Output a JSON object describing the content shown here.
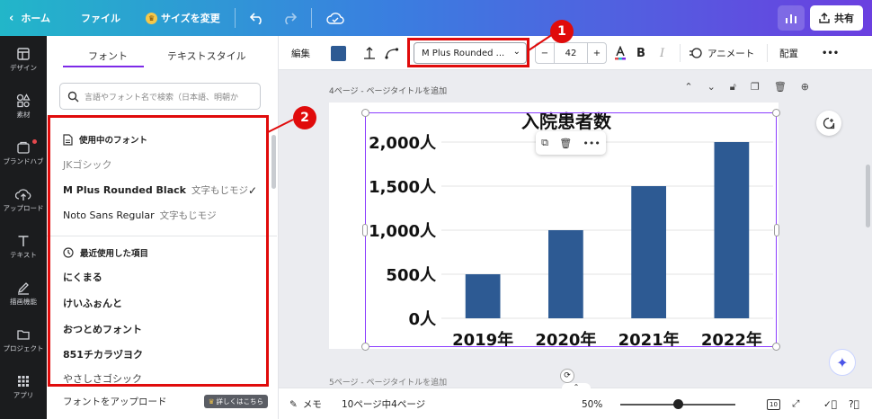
{
  "topbar": {
    "home": "ホーム",
    "file": "ファイル",
    "resize": "サイズを変更",
    "share": "共有"
  },
  "rail": [
    {
      "label": "デザイン",
      "icon": "layout-icon"
    },
    {
      "label": "素材",
      "icon": "shapes-icon"
    },
    {
      "label": "ブランドハブ",
      "icon": "brand-icon"
    },
    {
      "label": "アップロード",
      "icon": "upload-icon"
    },
    {
      "label": "テキスト",
      "icon": "text-icon"
    },
    {
      "label": "描画機能",
      "icon": "draw-icon"
    },
    {
      "label": "プロジェクト",
      "icon": "folder-icon"
    },
    {
      "label": "アプリ",
      "icon": "apps-icon"
    }
  ],
  "panel": {
    "tabs": [
      "フォント",
      "テキストスタイル"
    ],
    "search_placeholder": "言語やフォント名で検索（日本語、明朝か",
    "in_use_header": "使用中のフォント",
    "in_use": [
      {
        "name": "JKゴシック",
        "sample": ""
      },
      {
        "name": "M Plus Rounded Black",
        "sample": "文字もじモジ"
      },
      {
        "name": "Noto Sans Regular",
        "sample": "文字もじモジ"
      }
    ],
    "recent_header": "最近使用した項目",
    "recent": [
      "にくまる",
      "けいふぉんと",
      "おつとめフォント",
      "851チカラヅヨク",
      "やさしさゴシック"
    ],
    "upload": "フォントをアップロード",
    "upload_badge": "詳しくはこちら"
  },
  "annotations": [
    "1",
    "2"
  ],
  "toolbar": {
    "edit": "編集",
    "color": "#2d5a93",
    "font_name": "M Plus Rounded ...",
    "font_size": "42",
    "bold": "B",
    "italic": "I",
    "animate": "アニメート",
    "arrange": "配置",
    "more": "•••",
    "minus": "−",
    "plus": "+"
  },
  "canvas": {
    "page_label": "4ページ - ページタイトルを追加",
    "next_page_label": "5ページ - ページタイトルを追加"
  },
  "chart_data": {
    "type": "bar",
    "title": "入院患者数",
    "categories": [
      "2019年",
      "2020年",
      "2021年",
      "2022年"
    ],
    "values": [
      500,
      1000,
      1500,
      2000
    ],
    "yticks": [
      "0人",
      "500人",
      "1,000人",
      "1,500人",
      "2,000人"
    ],
    "ylim": [
      0,
      2000
    ],
    "color": "#2d5a93",
    "grid": true
  },
  "bottombar": {
    "notes": "メモ",
    "page_count": "10ページ中4ページ",
    "zoom": "50%",
    "pages_badge": "10"
  }
}
